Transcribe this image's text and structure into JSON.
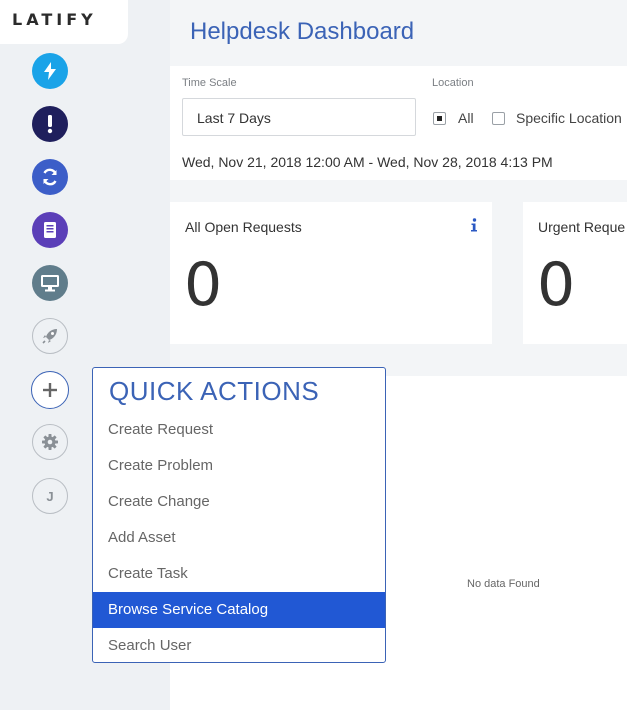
{
  "brand": {
    "logo_text": "LATIFY"
  },
  "sidebar": {
    "items": [
      {
        "name": "bolt-icon",
        "color": "#1aa3e8"
      },
      {
        "name": "exclamation-icon",
        "color": "#1f1f5c"
      },
      {
        "name": "refresh-icon",
        "color": "#3c5ec8"
      },
      {
        "name": "book-icon",
        "color": "#5b3fb8"
      },
      {
        "name": "monitor-icon",
        "color": "#607d8b"
      },
      {
        "name": "rocket-icon",
        "color": "#9aa0a6"
      },
      {
        "name": "plus-icon",
        "color": "#3b63b6"
      },
      {
        "name": "gear-icon",
        "color": "#9aa0a6"
      },
      {
        "name": "user-initial-icon",
        "label": "J",
        "color": "#9aa0a6"
      }
    ]
  },
  "header": {
    "title": "Helpdesk Dashboard"
  },
  "filters": {
    "time_scale_label": "Time Scale",
    "time_scale_value": "Last 7 Days",
    "location_label": "Location",
    "location_all": "All",
    "location_specific": "Specific Location",
    "date_range": "Wed, Nov 21, 2018 12:00 AM - Wed, Nov 28, 2018 4:13 PM"
  },
  "cards": [
    {
      "title": "All Open Requests",
      "value": "0"
    },
    {
      "title": "Urgent Reque",
      "value": "0"
    }
  ],
  "chart": {
    "empty_text": "No data Found"
  },
  "quick_actions": {
    "title": "QUICK ACTIONS",
    "items": [
      {
        "label": "Create Request"
      },
      {
        "label": "Create Problem"
      },
      {
        "label": "Create Change"
      },
      {
        "label": "Add Asset"
      },
      {
        "label": "Create Task"
      },
      {
        "label": "Browse Service Catalog",
        "highlighted": true
      },
      {
        "label": "Search User"
      }
    ]
  },
  "colors": {
    "accent": "#3b63b6",
    "highlight": "#2158d4"
  }
}
